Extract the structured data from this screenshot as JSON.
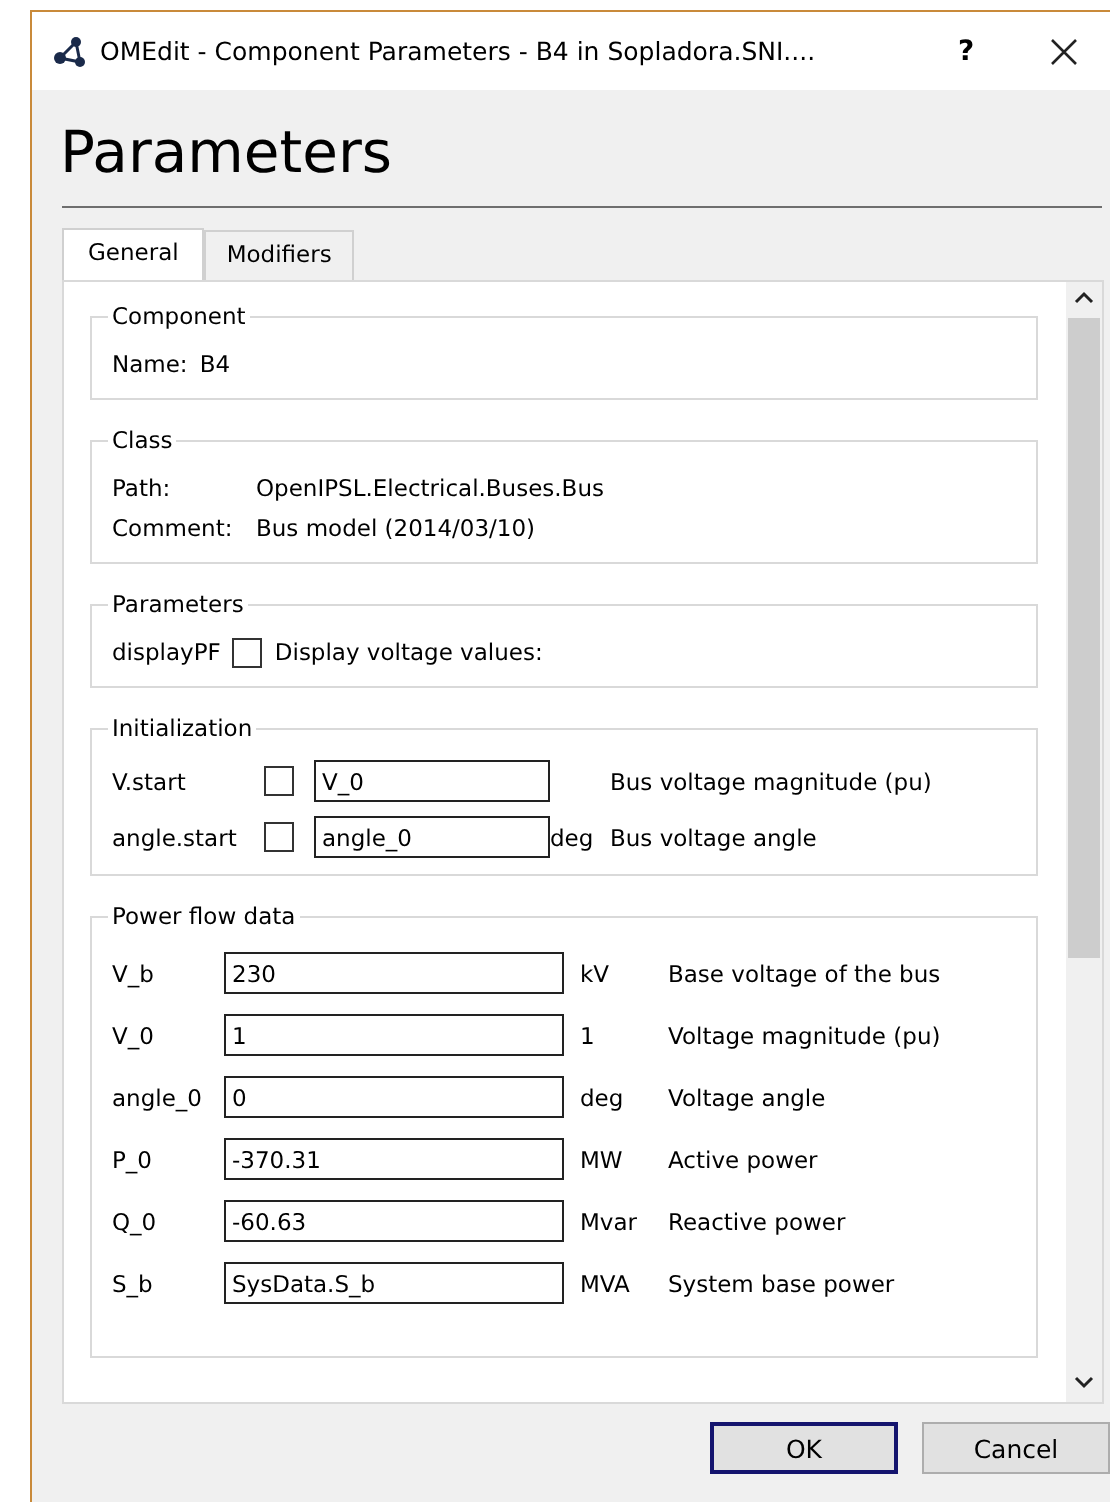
{
  "window": {
    "title": "OMEdit - Component Parameters - B4 in Sopladora.SNI....",
    "help": "?"
  },
  "heading": "Parameters",
  "tabs": [
    {
      "label": "General",
      "selected": true
    },
    {
      "label": "Modifiers",
      "selected": false
    }
  ],
  "component": {
    "title": "Component",
    "name_label": "Name:",
    "name_value": "B4"
  },
  "class": {
    "title": "Class",
    "rows": [
      {
        "label": "Path:",
        "value": "OpenIPSL.Electrical.Buses.Bus"
      },
      {
        "label": "Comment:",
        "value": "Bus model (2014/03/10)"
      }
    ]
  },
  "parameters": {
    "title": "Parameters",
    "name": "displayPF",
    "checked": false,
    "description": "Display voltage values:"
  },
  "initialization": {
    "title": "Initialization",
    "rows": [
      {
        "name": "V.start",
        "checked": false,
        "value": "V_0",
        "description": "Bus voltage magnitude (pu)"
      },
      {
        "name": "angle.start",
        "checked": false,
        "value": "angle_0",
        "unit": "deg",
        "description": "Bus voltage angle"
      }
    ]
  },
  "power_flow_data": {
    "title": "Power flow data",
    "rows": [
      {
        "name": "V_b",
        "value": "230",
        "unit": "kV",
        "description": "Base voltage of the bus"
      },
      {
        "name": "V_0",
        "value": "1",
        "unit": "1",
        "description": "Voltage magnitude (pu)"
      },
      {
        "name": "angle_0",
        "value": "0",
        "unit": "deg",
        "description": "Voltage angle"
      },
      {
        "name": "P_0",
        "value": "-370.31",
        "unit": "MW",
        "description": "Active power"
      },
      {
        "name": "Q_0",
        "value": "-60.63",
        "unit": "Mvar",
        "description": "Reactive power"
      },
      {
        "name": "S_b",
        "value": "SysData.S_b",
        "unit": "MVA",
        "description": "System base power"
      }
    ]
  },
  "buttons": [
    {
      "label": "OK",
      "kind": "default"
    },
    {
      "label": "Cancel",
      "kind": "normal"
    }
  ]
}
